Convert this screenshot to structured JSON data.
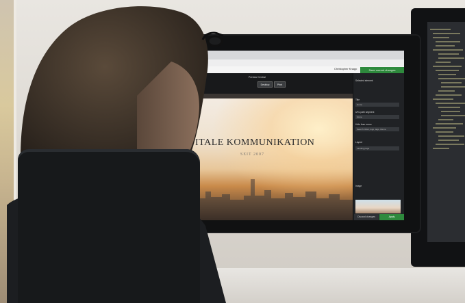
{
  "cms": {
    "user_name": "Christopher Knapp",
    "top_action_label": "Save current changes",
    "preview_title": "Preview Central",
    "preview_modes": [
      "Desktop",
      "Print"
    ],
    "hero_title": "ITALE KOMMUNIKATION",
    "hero_subtitle": "SEIT 2007",
    "inspector": {
      "section_label": "Selected element",
      "fields": [
        {
          "label": "Title",
          "value": "Home"
        },
        {
          "label": "URL path segment",
          "value": "home"
        },
        {
          "label": "Hide from menu",
          "value": "Search Order, logo, tags, theme"
        },
        {
          "label": "Layout",
          "value": "Landing page"
        },
        {
          "label": "Image",
          "value": ""
        }
      ]
    },
    "discard_label": "Discard changes",
    "apply_label": "Apply"
  },
  "icons": [
    "glasses-icon",
    "pencil-icon",
    "eye-icon"
  ]
}
